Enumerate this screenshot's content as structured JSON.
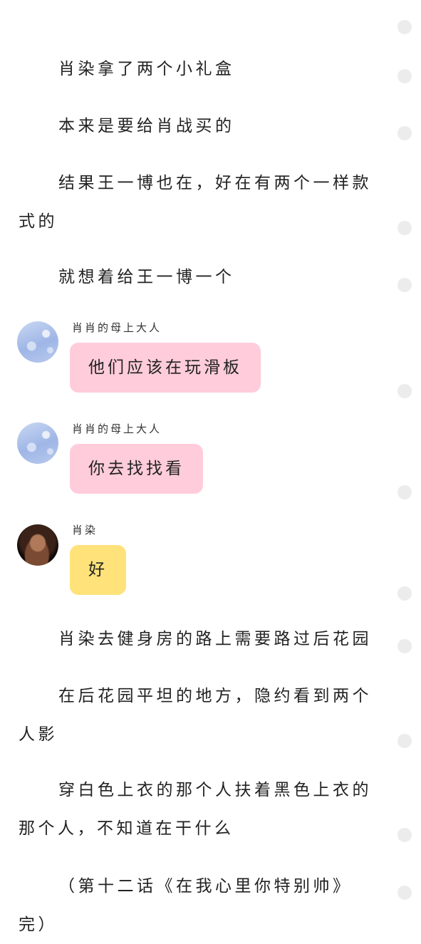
{
  "paragraphs_top": [
    "肖染拿了两个小礼盒",
    "本来是要给肖战买的",
    "结果王一博也在，好在有两个一样款式的",
    "就想着给王一博一个"
  ],
  "chat": [
    {
      "sender": "肖肖的母上大人",
      "text": "他们应该在玩滑板",
      "avatar": "sky-bubbles-avatar",
      "bubble_color": "#ffccdb"
    },
    {
      "sender": "肖肖的母上大人",
      "text": "你去找找看",
      "avatar": "sky-bubbles-avatar",
      "bubble_color": "#ffccdb"
    },
    {
      "sender": "肖染",
      "text": "好",
      "avatar": "girl-photo-avatar",
      "bubble_color": "#ffe27a"
    }
  ],
  "paragraphs_bottom": [
    "肖染去健身房的路上需要路过后花园",
    "在后花园平坦的地方，隐约看到两个人影",
    "穿白色上衣的那个人扶着黑色上衣的那个人，不知道在干什么",
    "（第十二话《在我心里你特别帅》完）"
  ]
}
